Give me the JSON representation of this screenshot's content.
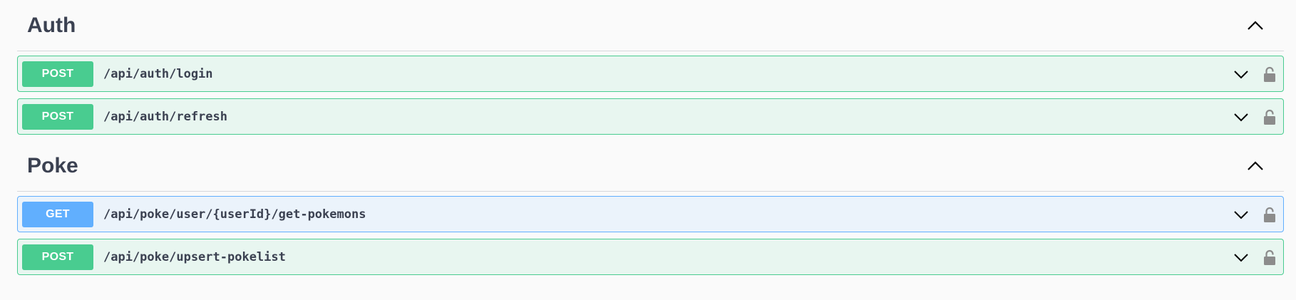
{
  "sections": [
    {
      "title": "Auth",
      "operations": [
        {
          "method": "POST",
          "path": "/api/auth/login"
        },
        {
          "method": "POST",
          "path": "/api/auth/refresh"
        }
      ]
    },
    {
      "title": "Poke",
      "operations": [
        {
          "method": "GET",
          "path": "/api/poke/user/{userId}/get-pokemons"
        },
        {
          "method": "POST",
          "path": "/api/poke/upsert-pokelist"
        }
      ]
    }
  ],
  "icons": {
    "collapse": "chevron-up-icon",
    "expand": "chevron-down-icon",
    "auth": "lock-icon"
  },
  "colors": {
    "post": "#49cc90",
    "get": "#61affe",
    "lock": "#8c8c8c"
  }
}
